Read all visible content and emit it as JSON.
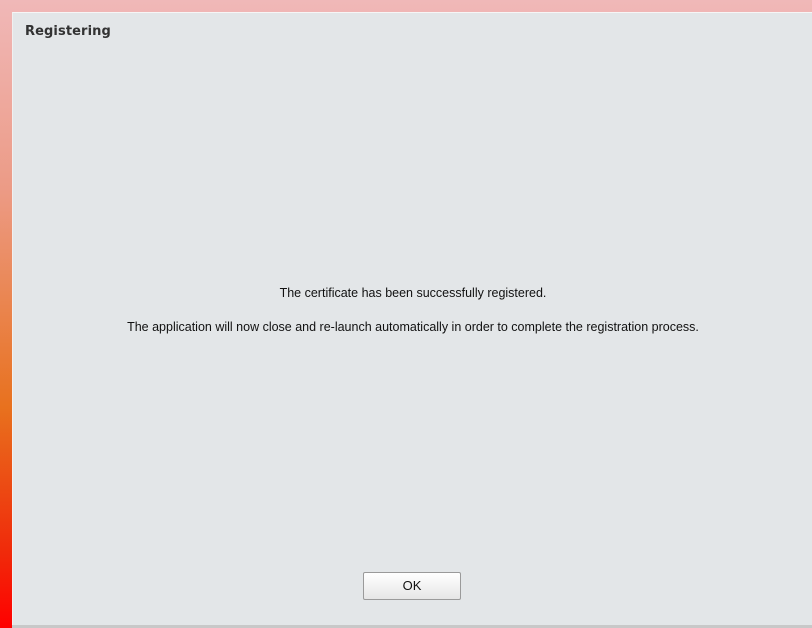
{
  "dialog": {
    "title": "Registering",
    "message_line_1": "The certificate has been successfully registered.",
    "message_line_2": "The application will now close and re-launch automatically in order to complete the registration process.",
    "ok_label": "OK"
  },
  "colors": {
    "frame_top": "#f0b8b8",
    "frame_bottom": "#ff0000",
    "background": "#e3e6e8"
  }
}
